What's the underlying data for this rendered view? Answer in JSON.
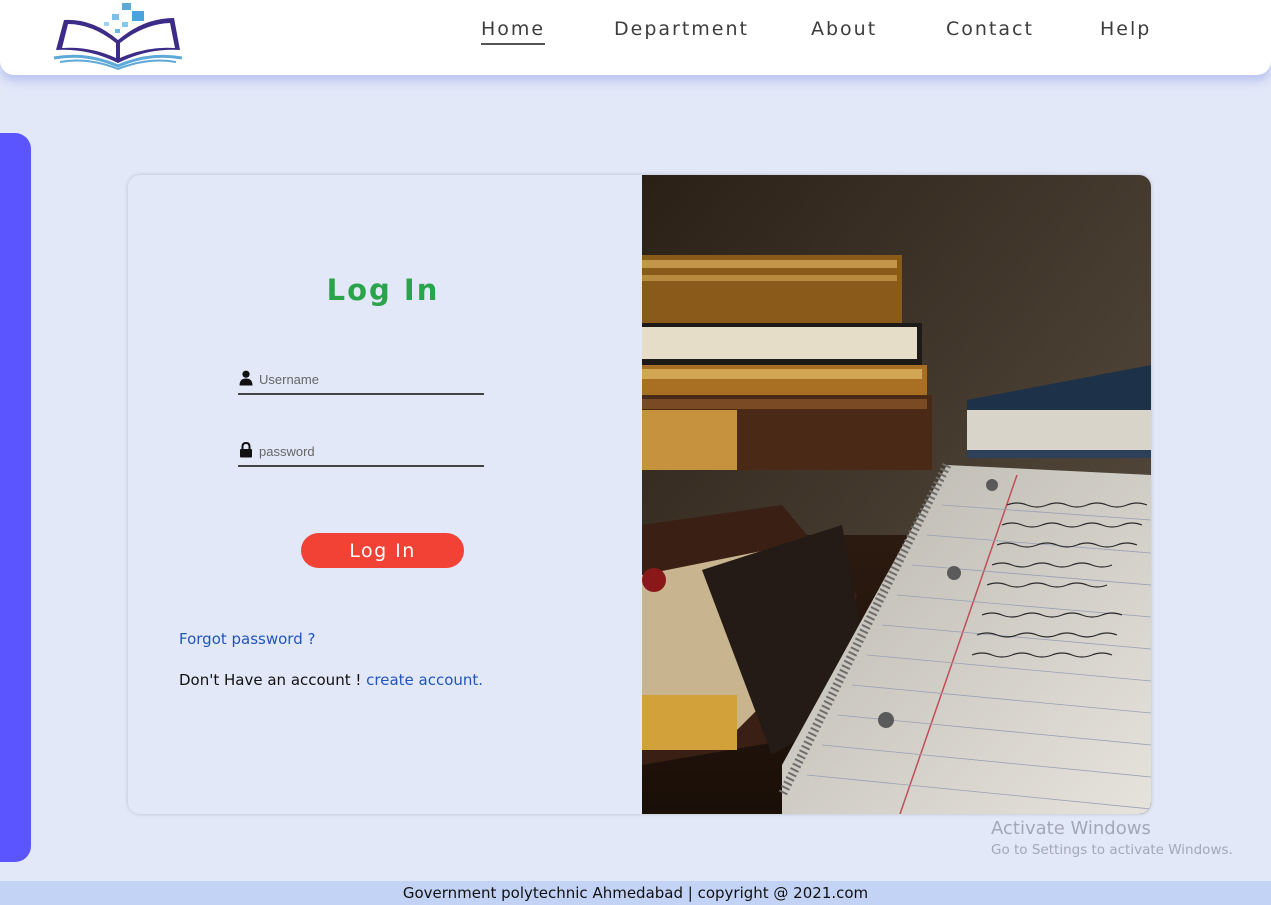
{
  "nav": {
    "items": [
      {
        "label": "Home",
        "active": true
      },
      {
        "label": "Department",
        "active": false
      },
      {
        "label": "About",
        "active": false
      },
      {
        "label": "Contact",
        "active": false
      },
      {
        "label": "Help",
        "active": false
      }
    ]
  },
  "login": {
    "title": "Log In",
    "username_placeholder": "Username",
    "password_placeholder": "password",
    "button_label": "Log In",
    "forgot_link": "Forgot password ?",
    "no_account_text": "Don't Have an account !",
    "create_account_link": "create account."
  },
  "watermark": {
    "line1": "Activate Windows",
    "line2": "Go to Settings to activate Windows."
  },
  "footer": {
    "text": "Government polytechnic Ahmedabad | copyright @ 2021.com"
  },
  "colors": {
    "accent_blue_bar": "#5a55ff",
    "title_green": "#2aa44a",
    "button_red": "#f24236",
    "link_blue": "#2255bb",
    "page_bg": "#e2e8f8",
    "footer_bg": "#c3d3f6"
  },
  "icons": {
    "logo": "open-book-logo-icon",
    "username": "user-icon",
    "password": "lock-icon"
  }
}
